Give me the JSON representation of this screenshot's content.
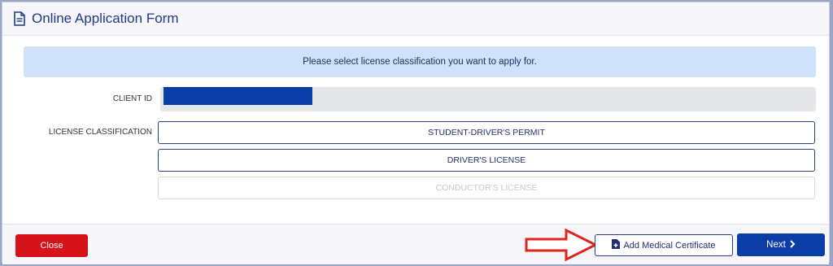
{
  "header": {
    "title": "Online Application Form",
    "icon": "document-icon"
  },
  "notice": {
    "text": "Please select license classification you want to apply for."
  },
  "form": {
    "client_id_label": "CLIENT ID",
    "license_classification_label": "LICENSE CLASSIFICATION",
    "options": [
      {
        "label": "STUDENT-DRIVER'S PERMIT",
        "enabled": true
      },
      {
        "label": "DRIVER'S LICENSE",
        "enabled": true
      },
      {
        "label": "CONDUCTOR'S LICENSE",
        "enabled": false
      }
    ]
  },
  "footer": {
    "close_label": "Close",
    "medical_label": "Add Medical Certificate",
    "medical_icon": "file-plus-icon",
    "next_label": "Next",
    "next_icon": "chevron-right-icon"
  },
  "colors": {
    "primary": "#0a3ea6",
    "danger": "#d6131b",
    "notice_bg": "#cfe2fb",
    "annotation_arrow": "#e0231c"
  }
}
